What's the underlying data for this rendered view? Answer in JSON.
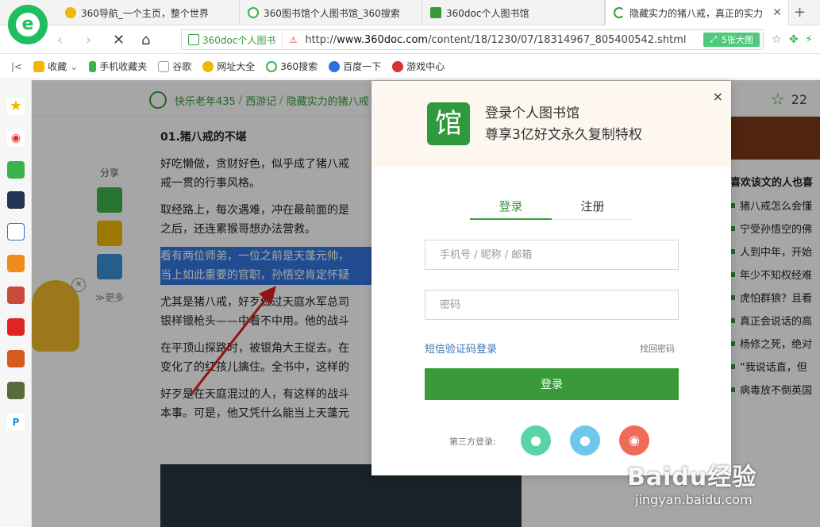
{
  "browser": {
    "tabs": [
      {
        "label": "360导航_一个主页，整个世界",
        "color": "#f0b800"
      },
      {
        "label": "360图书馆个人图书馆_360搜索",
        "color": "#3bb34a"
      },
      {
        "label": "360doc个人图书馆",
        "color": "#3a9a3a"
      },
      {
        "label": "隐藏实力的猪八戒，真正的实力",
        "color": "#3a9a3a"
      }
    ],
    "site_chip": "360doc个人图书",
    "url_prefix": "http://",
    "url_host": "www.360doc.com",
    "url_path": "/content/18/1230/07/18314967_805400542.shtml",
    "big_image_button": "5张大图"
  },
  "bookmarks": [
    {
      "label": "收藏",
      "color": "#f0b800"
    },
    {
      "label": "手机收藏夹",
      "color": "#3bb34a"
    },
    {
      "label": "谷歌",
      "color": "#999999"
    },
    {
      "label": "网址大全",
      "color": "#f0b800"
    },
    {
      "label": "360搜索",
      "color": "#3bb34a"
    },
    {
      "label": "百度一下",
      "color": "#2f6fe0"
    },
    {
      "label": "游戏中心",
      "color": "#d33333"
    }
  ],
  "page": {
    "breadcrumb": [
      "快乐老年435",
      "西游记",
      "隐藏实力的猪八戒"
    ],
    "favorite_count": "22",
    "share_label": "分享",
    "share_more": "更多",
    "article": {
      "heading": "01.猪八戒的不堪",
      "paragraphs": [
        "好吃懒做，贪财好色，似乎成了猪八戒",
        "戒一贯的行事风格。",
        "取经路上，每次遇难，冲在最前面的是",
        "之后，还连累猴哥想办法营救。",
        "看有两位师弟，一位之前是天蓬元帅，",
        "当上如此重要的官职，孙悟空肯定怀疑",
        "尤其是猪八戒，好歹做过天庭水军总司",
        "银样镴枪头——中看不中用。他的战斗",
        "在平顶山探路时，被银角大王捉去。在",
        "变化了的红孩儿擒住。全书中，这样的",
        "好歹是在天庭混过的人，有这样的战斗",
        "本事。可是，他又凭什么能当上天蓬元"
      ]
    },
    "right_col": {
      "heading": "喜欢该文的人也喜",
      "items": [
        "猪八戒怎么会懂",
        "宁受孙悟空的佛",
        "人到中年，开始",
        "年少不知权经难",
        "虎怕群狼？且看",
        "真正会说话的高",
        "杨修之死，绝对",
        "“我说话直，但",
        "病毒放不倒英国"
      ]
    }
  },
  "modal": {
    "title_line1": "登录个人图书馆",
    "title_line2": "尊享3亿好文永久复制特权",
    "logo_glyph": "馆",
    "tab_login": "登录",
    "tab_register": "注册",
    "account_placeholder": "手机号 / 昵称 / 邮箱",
    "password_placeholder": "密码",
    "sms_login": "短信验证码登录",
    "forgot_password": "找回密码",
    "login_button": "登录",
    "third_party_label": "第三方登录:",
    "close": "×"
  },
  "watermark": {
    "line1": "Baidu经验",
    "line2": "jingyan.baidu.com"
  }
}
